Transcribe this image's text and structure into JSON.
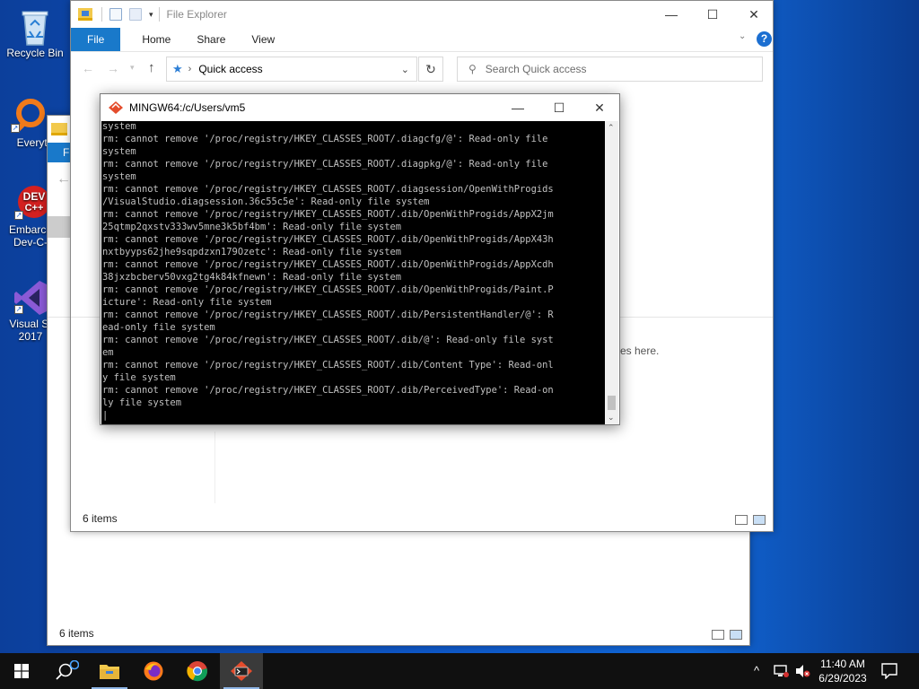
{
  "desktop": {
    "icons": [
      {
        "label_line1": "Recycle Bin",
        "label_line2": ""
      },
      {
        "label_line1": "Everyth",
        "label_line2": ""
      },
      {
        "label_line1": "Embarca",
        "label_line2": "Dev-C-"
      },
      {
        "label_line1": "Visual St",
        "label_line2": "2017"
      }
    ]
  },
  "explorer_back": {
    "title": "F",
    "status": "6 items"
  },
  "explorer": {
    "title": "File Explorer",
    "ribbon_tabs": [
      "File",
      "Home",
      "Share",
      "View"
    ],
    "address": "Quick access",
    "search_placeholder": "Search Quick access",
    "empty_hint": "es here.",
    "status": "6 items",
    "minimize": "—",
    "maximize": "☐",
    "close": "✕",
    "help": "?"
  },
  "terminal": {
    "title": "MINGW64:/c/Users/vm5",
    "lines": [
      "system",
      "rm: cannot remove '/proc/registry/HKEY_CLASSES_ROOT/.diagcfg/@': Read-only file",
      "system",
      "rm: cannot remove '/proc/registry/HKEY_CLASSES_ROOT/.diagpkg/@': Read-only file",
      "system",
      "rm: cannot remove '/proc/registry/HKEY_CLASSES_ROOT/.diagsession/OpenWithProgids",
      "/VisualStudio.diagsession.36c55c5e': Read-only file system",
      "rm: cannot remove '/proc/registry/HKEY_CLASSES_ROOT/.dib/OpenWithProgids/AppX2jm",
      "25qtmp2qxstv333wv5mne3k5bf4bm': Read-only file system",
      "rm: cannot remove '/proc/registry/HKEY_CLASSES_ROOT/.dib/OpenWithProgids/AppX43h",
      "nxtbyyps62jhe9sqpdzxn179Ozetc': Read-only file system",
      "rm: cannot remove '/proc/registry/HKEY_CLASSES_ROOT/.dib/OpenWithProgids/AppXcdh",
      "38jxzbcberv50vxg2tg4k84kfnewn': Read-only file system",
      "rm: cannot remove '/proc/registry/HKEY_CLASSES_ROOT/.dib/OpenWithProgids/Paint.P",
      "icture': Read-only file system",
      "rm: cannot remove '/proc/registry/HKEY_CLASSES_ROOT/.dib/PersistentHandler/@': R",
      "ead-only file system",
      "rm: cannot remove '/proc/registry/HKEY_CLASSES_ROOT/.dib/@': Read-only file syst",
      "em",
      "rm: cannot remove '/proc/registry/HKEY_CLASSES_ROOT/.dib/Content Type': Read-onl",
      "y file system",
      "rm: cannot remove '/proc/registry/HKEY_CLASSES_ROOT/.dib/PerceivedType': Read-on",
      "ly file system",
      "|"
    ],
    "minimize": "—",
    "maximize": "☐",
    "close": "✕"
  },
  "taskbar": {
    "time": "11:40 AM",
    "date": "6/29/2023"
  },
  "colors": {
    "accent": "#1979ca",
    "terminal_bg": "#000000",
    "terminal_fg": "#c0c0c0",
    "taskbar": "#101010"
  }
}
